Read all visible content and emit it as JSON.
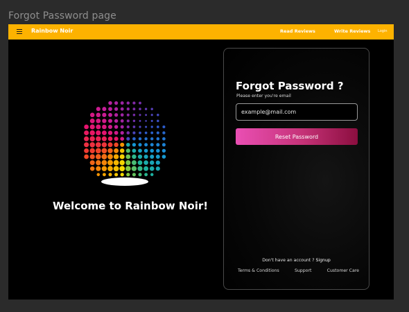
{
  "frame_title": "Forgot Password page",
  "navbar": {
    "brand": "Rainbow Noir",
    "links": [
      "Read Reviews",
      "Write Reviews",
      "Login"
    ],
    "background_color": "#fdb200"
  },
  "hero": {
    "welcome_text": "Welcome to Rainbow Noir!",
    "logo_icon": "rainbow-dotted-sphere-icon"
  },
  "card": {
    "title": "Forgot Password ?",
    "subtitle": "Please enter you're email",
    "email_placeholder": "example@mail.com",
    "reset_button": "Reset Password",
    "signup_prompt": "Don't have an account ?",
    "signup_link": "Signup",
    "footer_links": [
      "Terms & Conditions",
      "Support",
      "Customer Care"
    ],
    "button_gradient": [
      "#ea4fb4",
      "#8b0e3f"
    ]
  }
}
